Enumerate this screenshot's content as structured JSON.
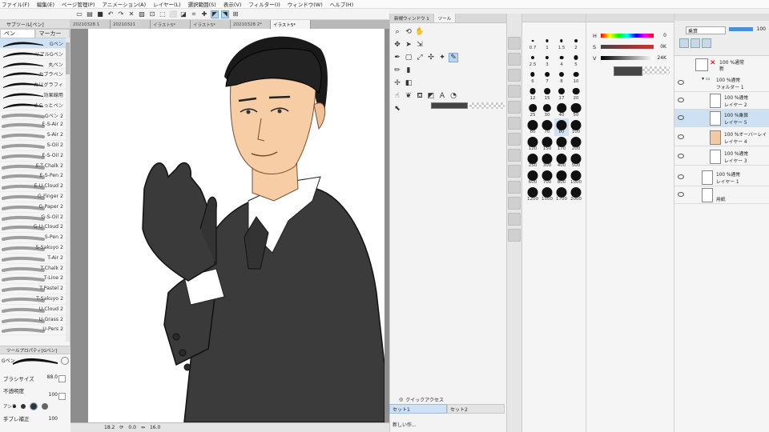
{
  "menu": [
    "ファイル(F)",
    "編集(E)",
    "ページ管理(P)",
    "アニメーション(A)",
    "レイヤー(L)",
    "選択範囲(S)",
    "表示(V)",
    "フィルター(I)",
    "ウィンドウ(W)",
    "ヘルプ(H)"
  ],
  "doc_tabs": [
    "20210328 1",
    "20210321",
    "イラスト5*",
    "イラスト5*",
    "20210328 2*",
    "イラスト5*"
  ],
  "left_panel": {
    "header": "サブツール[ペン]",
    "tab_pen": "ペン",
    "tab_marker": "マーカー",
    "brushes": [
      "Gペン",
      "リアルGペン",
      "丸ペン",
      "カブラペン",
      "カリグラフィ",
      "効果線用",
      "さらっとペン",
      "Gペン 2",
      "E-S-Air 2",
      "S-Air 2",
      "S-Oil 2",
      "E-S-Oil 2",
      "E-T-Chalk 2",
      "E-S-Pen 2",
      "E-U-Cloud 2",
      "G-Finger 2",
      "G-Paper 2",
      "G-S-Oil 2",
      "G-U-Cloud 2",
      "S-Pen 2",
      "S-Sakuyo 2",
      "T-Air 2",
      "T-Chalk 2",
      "T-Line 2",
      "T-Pastel 2",
      "T-Sakuyo 2",
      "U-Cloud 2",
      "U-Grass 2",
      "U-Pers 2"
    ]
  },
  "tool_property": {
    "header": "ツールプロパティ[Gペン]",
    "tool_name": "Gペン",
    "brush_size_label": "ブラシサイズ",
    "brush_size_value": "88.0",
    "opacity_label": "不透明度",
    "opacity_value": "100",
    "antialias_label": "アンチ",
    "stabilize_label": "手ブレ補正",
    "stabilize_value": "100"
  },
  "status": {
    "zoom": "18.2",
    "angle": "0.0",
    "size": "16.0"
  },
  "tool_panel": {
    "tabs": [
      "新規ウィンドウ 1",
      "ツール"
    ],
    "quick_access": "クイックアクセス",
    "sets": [
      "セット1",
      "セット2"
    ],
    "bottom_item": "新しい作..."
  },
  "brush_sizes": [
    "0.7",
    "1",
    "1.5",
    "2",
    "2.5",
    "3",
    "4",
    "5",
    "6",
    "7",
    "8",
    "10",
    "12",
    "15",
    "17",
    "20",
    "25",
    "30",
    "40",
    "50",
    "60",
    "70",
    "80",
    "100",
    "120",
    "150",
    "170",
    "200",
    "250",
    "300",
    "400",
    "500",
    "600",
    "700",
    "800",
    "1000",
    "1200",
    "1500",
    "1700",
    "2000"
  ],
  "brush_size_selected": "80",
  "color_sliders": [
    {
      "label": "H",
      "value": "0"
    },
    {
      "label": "S",
      "value": "0K"
    },
    {
      "label": "V",
      "value": "24K"
    }
  ],
  "layer_panel": {
    "blend_mode": "乗算",
    "opacity": "100",
    "new_label": "新",
    "layers": [
      {
        "l1": "100 %通常",
        "l2": "フォルダー 1"
      },
      {
        "l1": "100 %通常",
        "l2": "レイヤー 2"
      },
      {
        "l1": "100 %乗算",
        "l2": "レイヤー 5"
      },
      {
        "l1": "100 %オーバーレイ",
        "l2": "レイヤー 4"
      },
      {
        "l1": "100 %通常",
        "l2": "レイヤー 3"
      },
      {
        "l1": "100 %通常",
        "l2": "レイヤー 1"
      },
      {
        "l1": "",
        "l2": "用紙"
      }
    ]
  }
}
